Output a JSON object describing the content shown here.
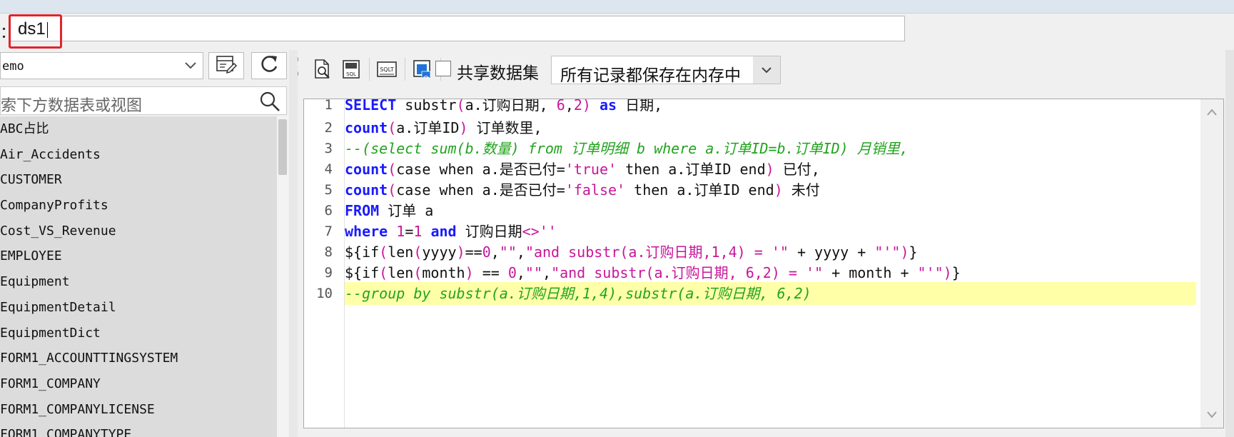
{
  "dataset_name": {
    "label": "：",
    "value": "ds1"
  },
  "left_panel": {
    "database": "emo",
    "search_placeholder": "索下方数据表或视图",
    "tables": [
      "ABC占比",
      "Air_Accidents",
      "CUSTOMER",
      "CompanyProfits",
      "Cost_VS_Revenue",
      "EMPLOYEE",
      "Equipment",
      "EquipmentDetail",
      "EquipmentDict",
      "FORM1_ACCOUNTTINGSYSTEM",
      "FORM1_COMPANY",
      "FORM1_COMPANYLICENSE",
      "FORM1_COMPANYTYPE"
    ]
  },
  "toolbar": {
    "share_label": "共享数据集",
    "memory_mode": "所有记录都保存在内存中",
    "icons": [
      "preview-icon",
      "sql-icon",
      "sql-format-icon",
      "save-param-icon"
    ]
  },
  "editor": {
    "line_numbers": [
      "1",
      "2",
      "3",
      "4",
      "5",
      "6",
      "7",
      "8",
      "9",
      "10"
    ],
    "active_line": 10
  },
  "colors": {
    "keyword": "#1a1aff",
    "string": "#c8169a",
    "comment": "#22a31e",
    "highlight": "#ffffa8",
    "red_box": "#e0242c"
  }
}
